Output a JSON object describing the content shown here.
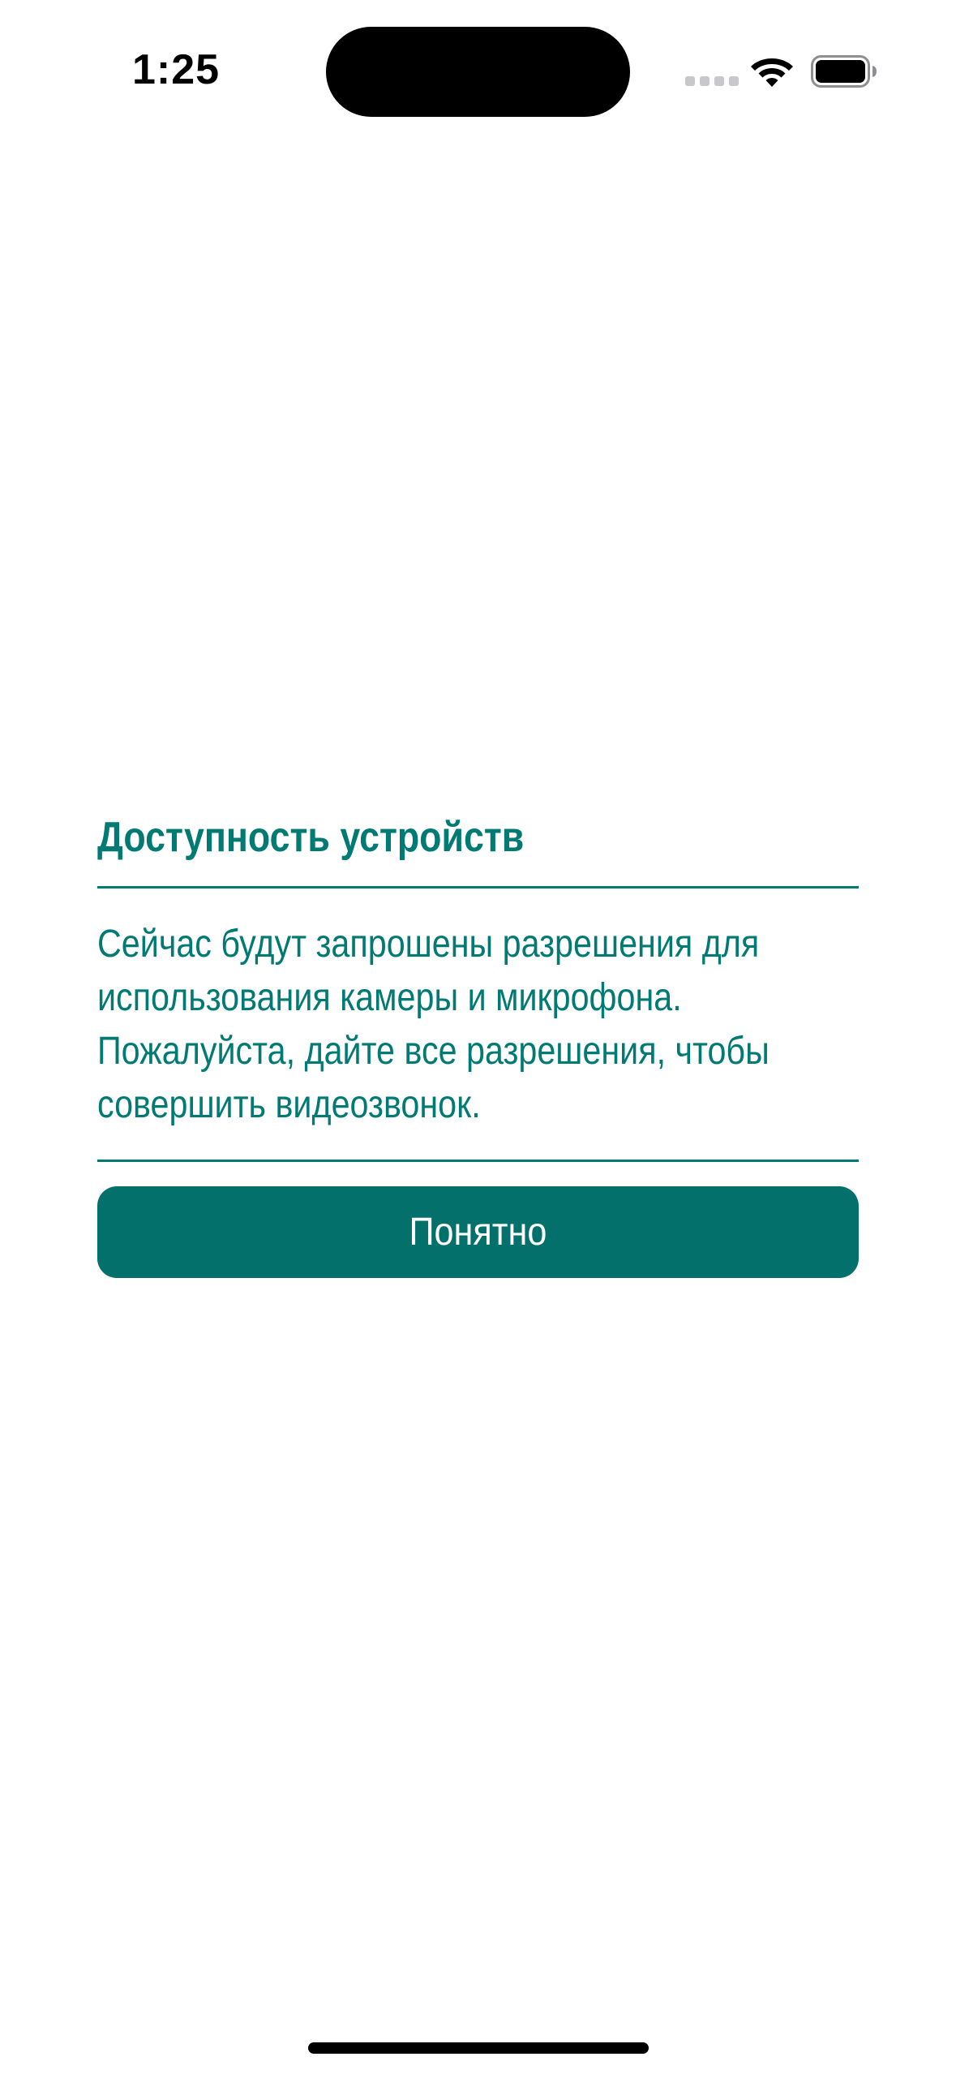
{
  "status_bar": {
    "time": "1:25",
    "icons": [
      "signal-icon",
      "wifi-icon",
      "battery-icon"
    ]
  },
  "dialog": {
    "title": "Доступность устройств",
    "message": "Сейчас будут запрошены разрешения для использования камеры и микрофона. Пожалуйста, дайте все разрешения, чтобы совершить видеозвонок.",
    "button_label": "Понятно"
  },
  "colors": {
    "accent": "#007a73",
    "button_background": "#03706b",
    "button_text": "#ffffff",
    "background": "#ffffff"
  }
}
